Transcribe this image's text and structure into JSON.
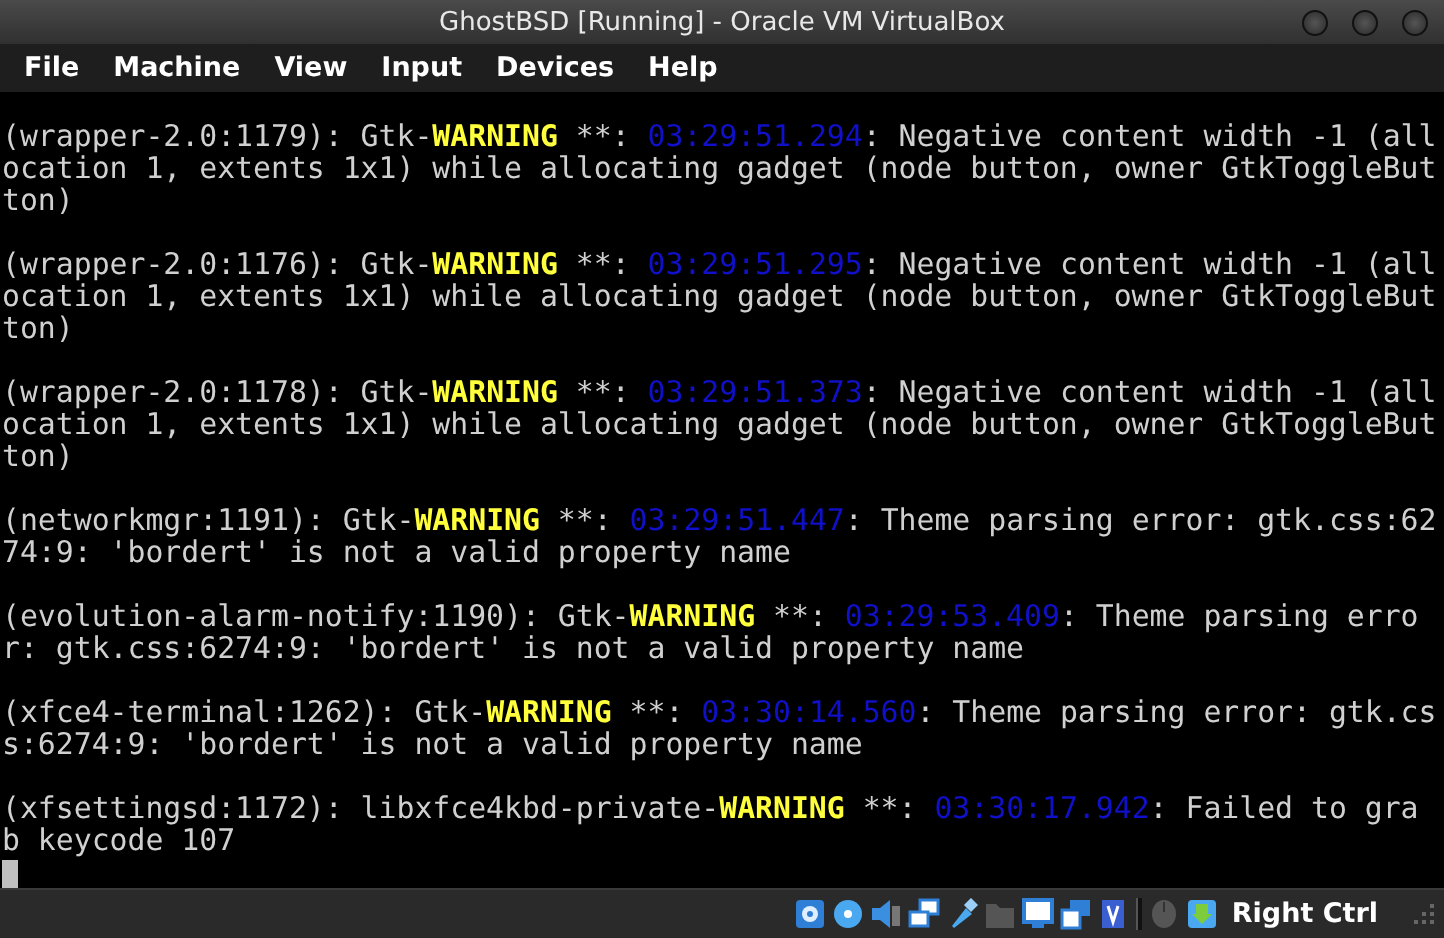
{
  "window": {
    "title": "GhostBSD [Running] - Oracle VM VirtualBox"
  },
  "menu": [
    "File",
    "Machine",
    "View",
    "Input",
    "Devices",
    "Help"
  ],
  "console": {
    "messages": [
      {
        "prefix": "(wrapper-2.0:1179): Gtk-",
        "level": "WARNING",
        "after_level": " **: ",
        "time": "03:29:51.294",
        "message": ": Negative content width -1 (allocation 1, extents 1x1) while allocating gadget (node button, owner GtkToggleButton)"
      },
      {
        "prefix": "(wrapper-2.0:1176): Gtk-",
        "level": "WARNING",
        "after_level": " **: ",
        "time": "03:29:51.295",
        "message": ": Negative content width -1 (allocation 1, extents 1x1) while allocating gadget (node button, owner GtkToggleButton)"
      },
      {
        "prefix": "(wrapper-2.0:1178): Gtk-",
        "level": "WARNING",
        "after_level": " **: ",
        "time": "03:29:51.373",
        "message": ": Negative content width -1 (allocation 1, extents 1x1) while allocating gadget (node button, owner GtkToggleButton)"
      },
      {
        "prefix": "(networkmgr:1191): Gtk-",
        "level": "WARNING",
        "after_level": " **: ",
        "time": "03:29:51.447",
        "message": ": Theme parsing error: gtk.css:6274:9: 'bordert' is not a valid property name"
      },
      {
        "prefix": "(evolution-alarm-notify:1190): Gtk-",
        "level": "WARNING",
        "after_level": " **: ",
        "time": "03:29:53.409",
        "message": ": Theme parsing error: gtk.css:6274:9: 'bordert' is not a valid property name"
      },
      {
        "prefix": "(xfce4-terminal:1262): Gtk-",
        "level": "WARNING",
        "after_level": " **: ",
        "time": "03:30:14.560",
        "message": ": Theme parsing error: gtk.css:6274:9: 'bordert' is not a valid property name"
      },
      {
        "prefix": "(xfsettingsd:1172): libxfce4kbd-private-",
        "level": "WARNING",
        "after_level": " **: ",
        "time": "03:30:17.942",
        "message": ": Failed to grab keycode 107"
      }
    ]
  },
  "status_bar": {
    "host_key": "Right Ctrl"
  }
}
